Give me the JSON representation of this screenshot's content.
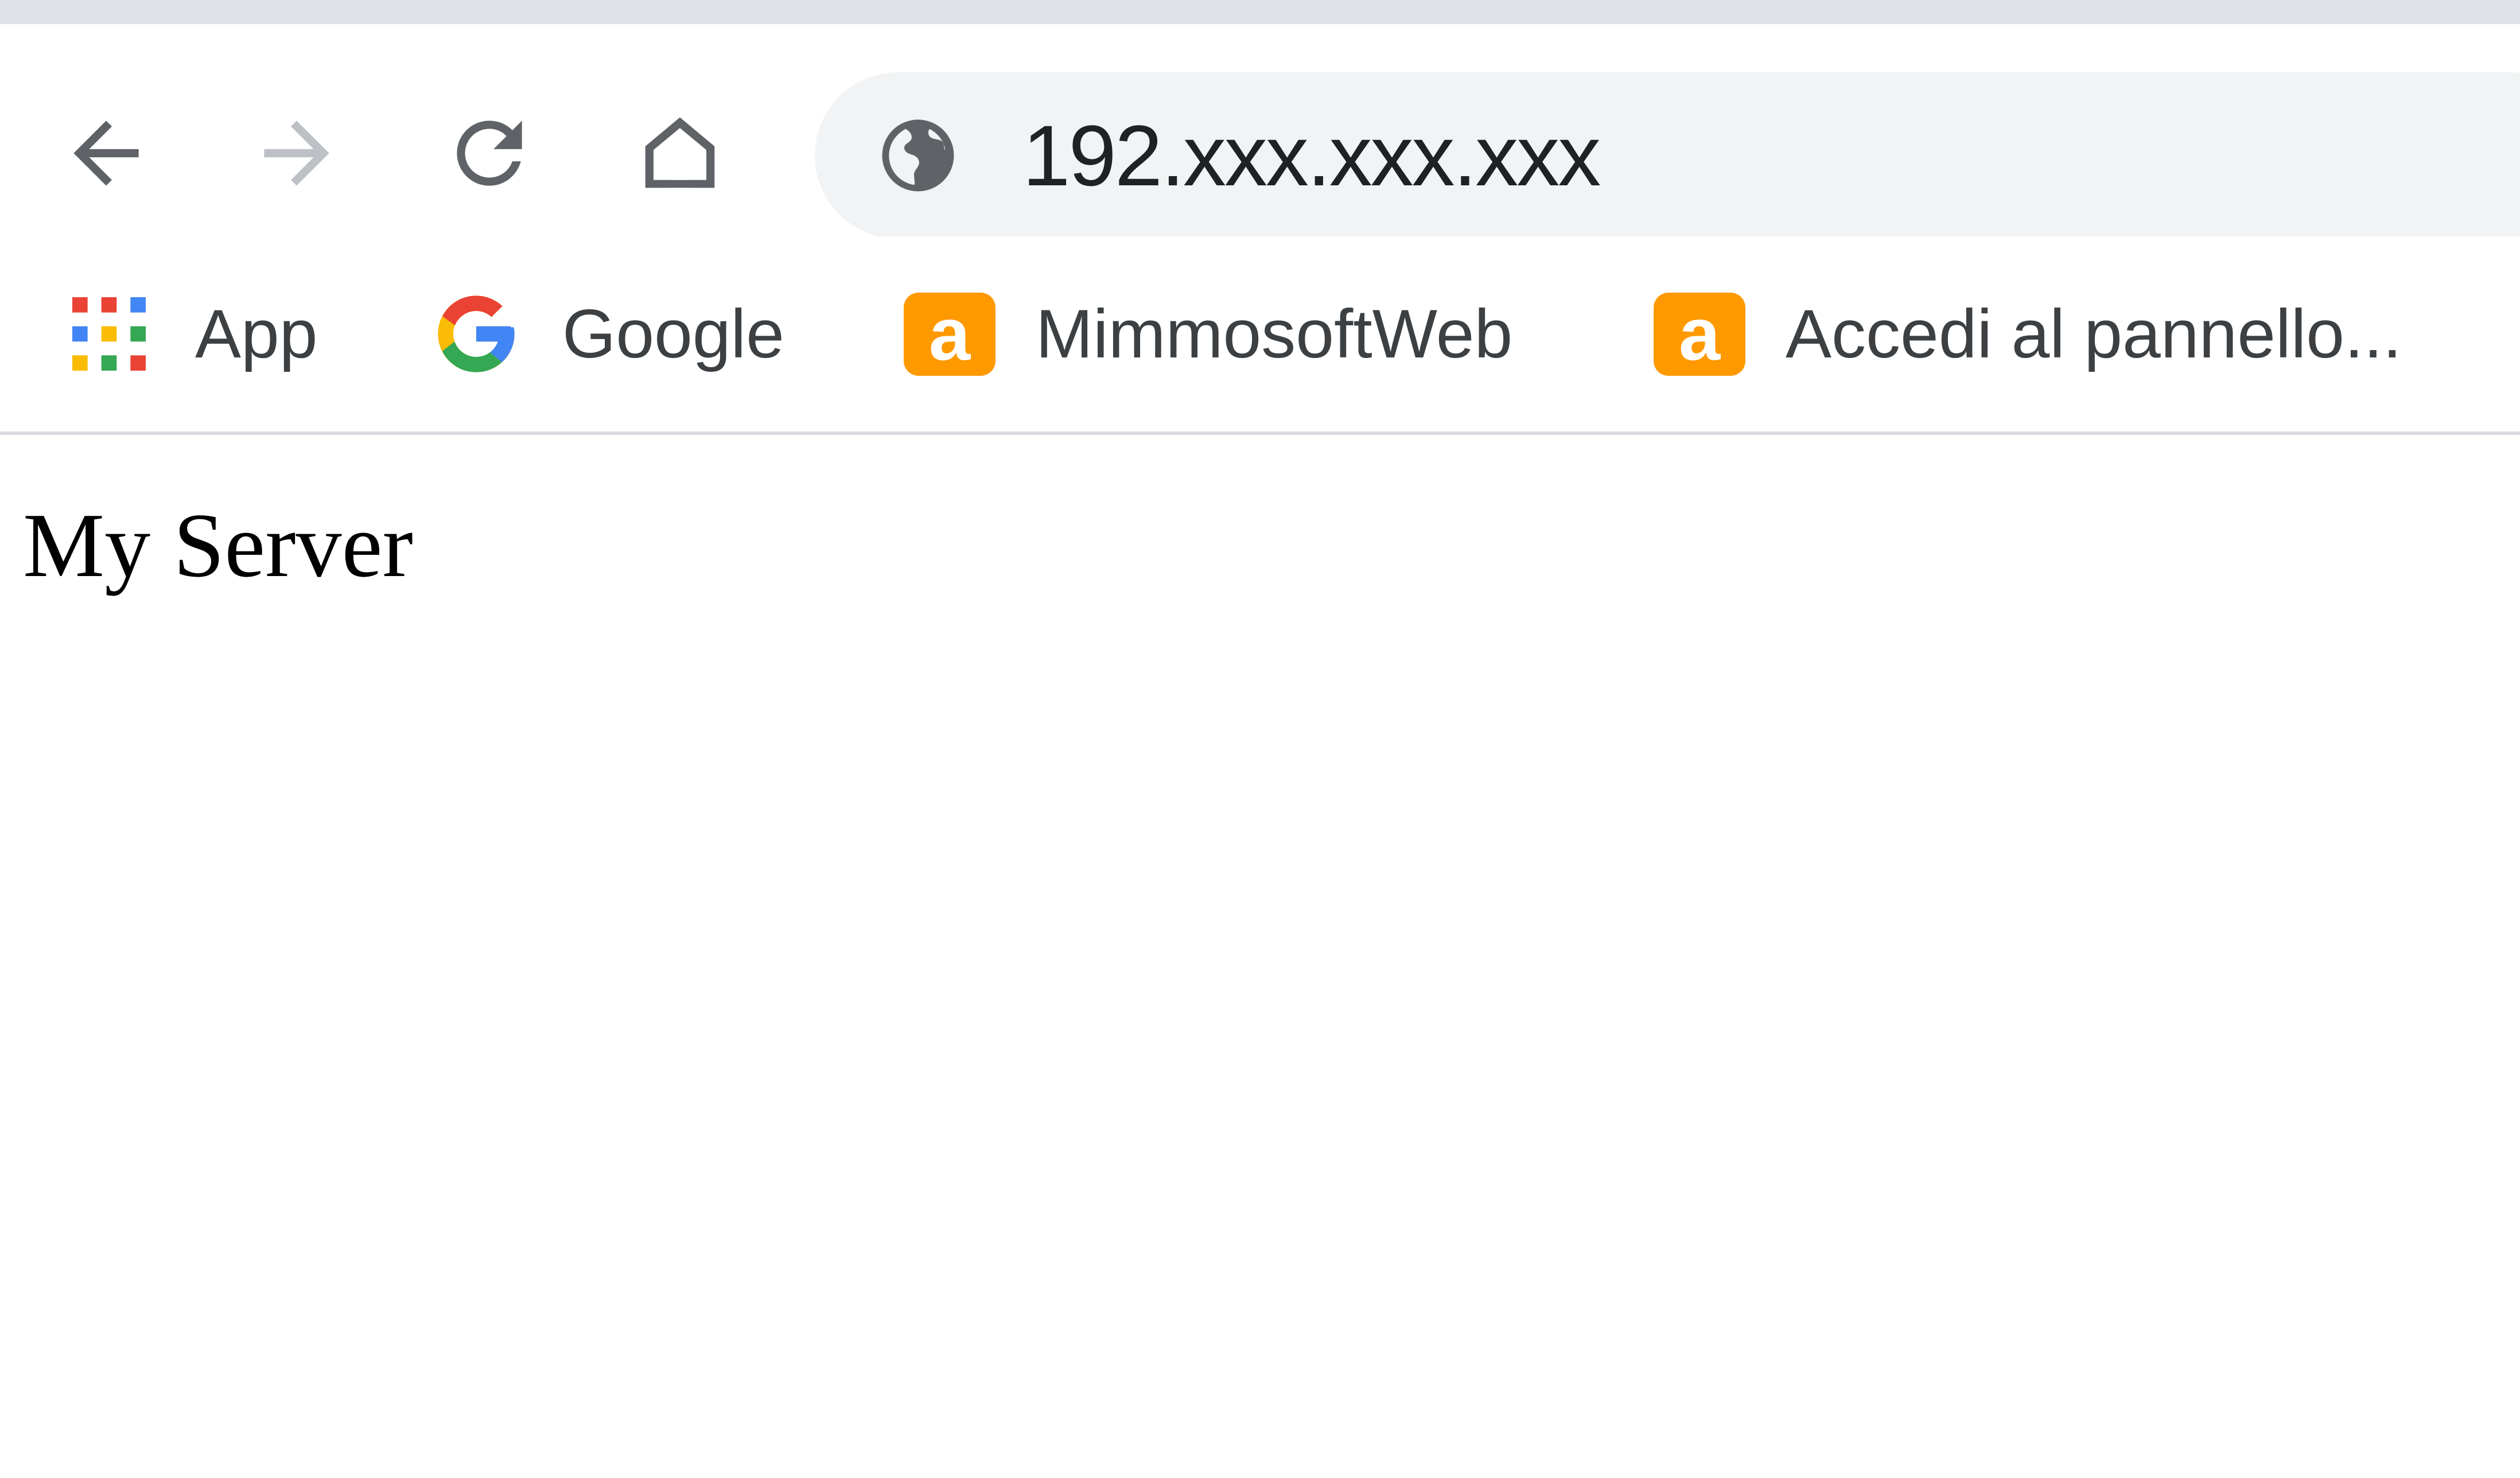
{
  "toolbar": {
    "url": "192.xxx.xxx.xxx",
    "back_icon": "arrow-left-icon",
    "forward_icon": "arrow-right-icon",
    "reload_icon": "reload-icon",
    "home_icon": "home-icon",
    "site_info_icon": "globe-icon"
  },
  "bookmarks": [
    {
      "label": "App",
      "icon": "apps-grid-icon"
    },
    {
      "label": "Google",
      "icon": "google-g-icon"
    },
    {
      "label": "MimmosoftWeb",
      "icon": "amazon-a-icon",
      "icon_letter": "a"
    },
    {
      "label": "Accedi al pannello...",
      "icon": "amazon-a-icon",
      "icon_letter": "a"
    }
  ],
  "page": {
    "body_text": "My Server"
  },
  "colors": {
    "omnibox_bg": "#f1f3f4",
    "amazon_orange": "#ff9900",
    "top_strip": "#dee1e6",
    "icon_active": "#5f6368",
    "icon_disabled": "#bdc1c6"
  }
}
